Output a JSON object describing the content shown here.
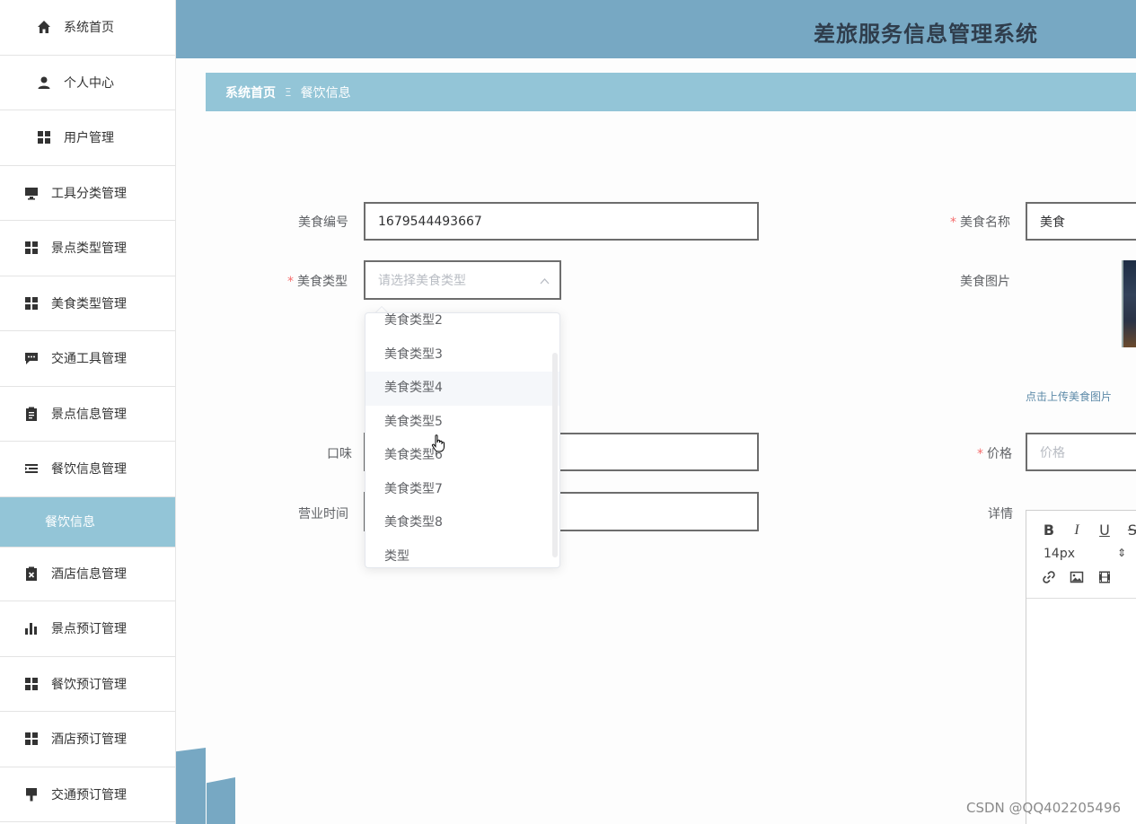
{
  "header": {
    "title": "差旅服务信息管理系统"
  },
  "breadcrumb": {
    "home": "系统首页",
    "separator": "Ξ",
    "current": "餐饮信息"
  },
  "sidebar": {
    "items": [
      {
        "label": "系统首页",
        "icon": "home-icon"
      },
      {
        "label": "个人中心",
        "icon": "user-icon"
      },
      {
        "label": "用户管理",
        "icon": "grid-icon"
      },
      {
        "label": "工具分类管理",
        "icon": "monitor-icon"
      },
      {
        "label": "景点类型管理",
        "icon": "grid-icon"
      },
      {
        "label": "美食类型管理",
        "icon": "grid-icon"
      },
      {
        "label": "交通工具管理",
        "icon": "chat-icon"
      },
      {
        "label": "景点信息管理",
        "icon": "clipboard-icon"
      },
      {
        "label": "餐饮信息管理",
        "icon": "list-icon"
      },
      {
        "label": "餐饮信息",
        "active": true
      },
      {
        "label": "酒店信息管理",
        "icon": "clipboard-x-icon"
      },
      {
        "label": "景点预订管理",
        "icon": "bar-chart-icon"
      },
      {
        "label": "餐饮预订管理",
        "icon": "grid-icon"
      },
      {
        "label": "酒店预订管理",
        "icon": "grid-icon"
      },
      {
        "label": "交通预订管理",
        "icon": "brush-icon"
      }
    ]
  },
  "form": {
    "food_no": {
      "label": "美食编号",
      "value": "1679544493667"
    },
    "food_name": {
      "label": "美食名称",
      "value": "美食",
      "required": "*"
    },
    "food_type": {
      "label": "美食类型",
      "placeholder": "请选择美食类型",
      "required": "*"
    },
    "food_image": {
      "label": "美食图片",
      "upload_text": "点击上传美食图片"
    },
    "taste": {
      "label": "口味",
      "value": ""
    },
    "price": {
      "label": "价格",
      "placeholder": "价格",
      "required": "*"
    },
    "hours": {
      "label": "营业时间",
      "value": ""
    },
    "detail": {
      "label": "详情"
    }
  },
  "dropdown": {
    "options": [
      "美食类型2",
      "美食类型3",
      "美食类型4",
      "美食类型5",
      "美食类型6",
      "美食类型7",
      "美食类型8",
      "类型"
    ],
    "hovered": "美食类型4"
  },
  "editor": {
    "bold": "B",
    "italic": "I",
    "underline": "U",
    "strike": "S",
    "font_size": "14px",
    "font_size_arrow": "⇕"
  },
  "watermark": "CSDN @QQ402205496",
  "colors": {
    "header": "#77a8c3",
    "accent": "#93c5d7",
    "required": "#f56c6c"
  }
}
